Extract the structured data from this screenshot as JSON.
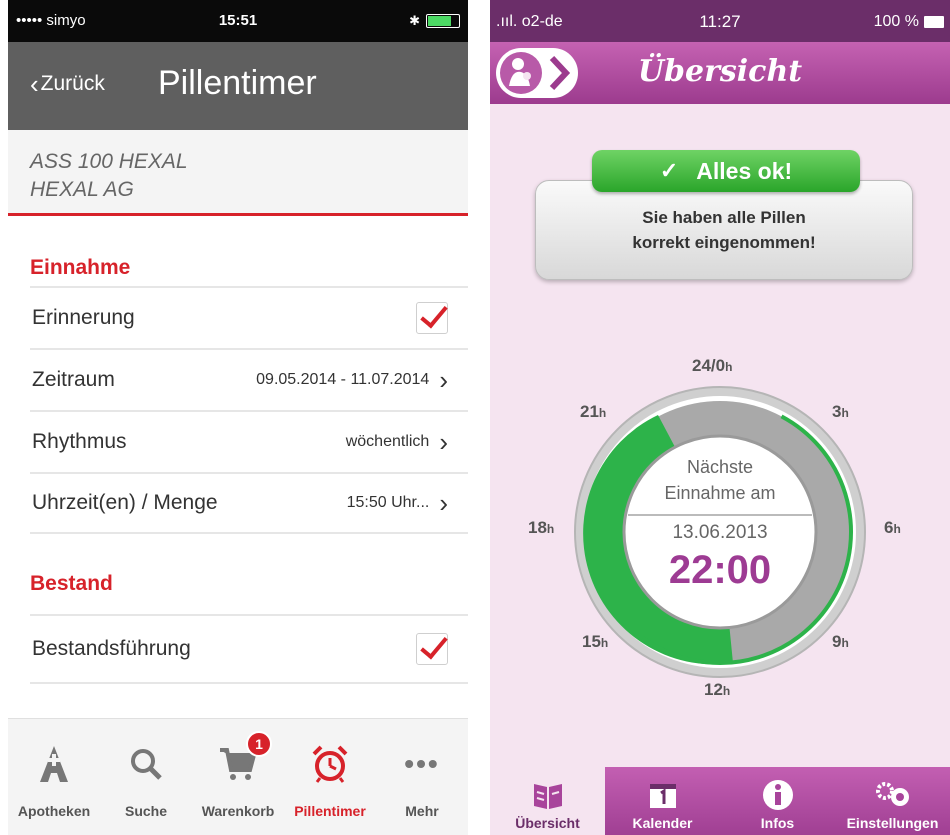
{
  "left": {
    "status": {
      "carrier": "••••• simyo",
      "time": "15:51"
    },
    "nav": {
      "back_label": "Zurück",
      "title": "Pillentimer"
    },
    "drug": {
      "name": "ASS 100 HEXAL",
      "maker": "HEXAL AG"
    },
    "section_intake": "Einnahme",
    "rows": [
      {
        "label": "Erinnerung",
        "checked": true
      },
      {
        "label": "Zeitraum",
        "value": "09.05.2014 - 11.07.2014"
      },
      {
        "label": "Rhythmus",
        "value": "wöchentlich"
      },
      {
        "label": "Uhrzeit(en) / Menge",
        "value": "15:50 Uhr..."
      }
    ],
    "section_stock": "Bestand",
    "stock_row": {
      "label": "Bestandsführung",
      "checked": true
    },
    "tabs": [
      {
        "label": "Apotheken",
        "icon": "pharmacy-icon"
      },
      {
        "label": "Suche",
        "icon": "search-icon"
      },
      {
        "label": "Warenkorb",
        "icon": "cart-icon",
        "badge": "1"
      },
      {
        "label": "Pillentimer",
        "icon": "alarm-clock-icon",
        "active": true
      },
      {
        "label": "Mehr",
        "icon": "more-icon"
      }
    ],
    "colors": {
      "accent": "#d7222a",
      "navbar": "#5f5f5f"
    }
  },
  "right": {
    "status": {
      "carrier": ".ııl. o2-de",
      "time": "11:27",
      "battery": "100 %"
    },
    "header": {
      "title": "Übersicht"
    },
    "ok_label": "Alles ok!",
    "message_line1": "Sie haben alle Pillen",
    "message_line2": "korrekt eingenommen!",
    "dial": {
      "labels": [
        "24/0",
        "3",
        "6",
        "9",
        "12",
        "15",
        "18",
        "21"
      ],
      "unit": "h"
    },
    "next": {
      "line1": "Nächste",
      "line2": "Einnahme am",
      "date": "13.06.2013",
      "time": "22:00"
    },
    "tabs": [
      {
        "label": "Übersicht",
        "icon": "book-icon",
        "active": true
      },
      {
        "label": "Kalender",
        "icon": "calendar-icon"
      },
      {
        "label": "Infos",
        "icon": "info-icon"
      },
      {
        "label": "Einstellungen",
        "icon": "gears-icon"
      }
    ],
    "colors": {
      "accent": "#a8449b",
      "ok_green": "#2aa52a"
    }
  }
}
